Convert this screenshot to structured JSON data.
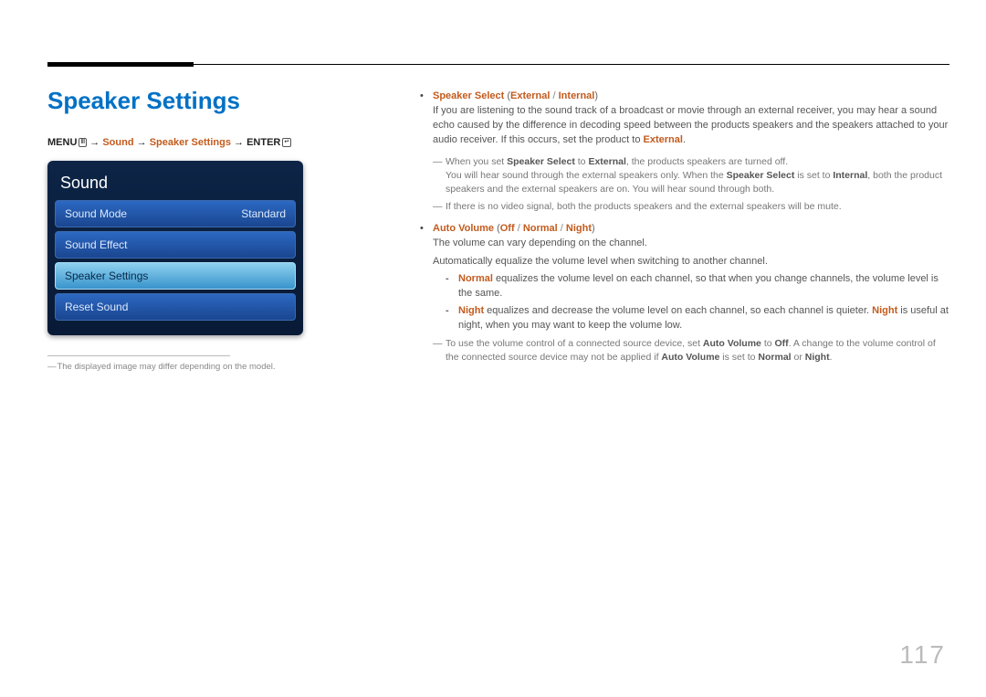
{
  "page_number": "117",
  "title": "Speaker Settings",
  "breadcrumb": {
    "menu": "MENU",
    "menu_icon": "Ⅲ",
    "arrow": "→",
    "sound": "Sound",
    "speaker_settings": "Speaker Settings",
    "enter": "ENTER",
    "enter_icon": "↵"
  },
  "osd": {
    "title": "Sound",
    "items": [
      {
        "label": "Sound Mode",
        "value": "Standard",
        "selected": false
      },
      {
        "label": "Sound Effect",
        "value": "",
        "selected": false
      },
      {
        "label": "Speaker Settings",
        "value": "",
        "selected": true
      },
      {
        "label": "Reset Sound",
        "value": "",
        "selected": false
      }
    ]
  },
  "left_footnote": "The displayed image may differ depending on the model.",
  "right": {
    "speaker_select": {
      "heading": "Speaker Select",
      "opt1": "External",
      "opt2": "Internal",
      "body": "If you are listening to the sound track of a broadcast or movie through an external receiver, you may hear a sound echo caused by the difference in decoding speed between the products speakers and the speakers attached to your audio receiver. If this occurs, set the product to ",
      "body_end_bold": "External",
      "note1_a": "When you set ",
      "note1_b": "Speaker Select",
      "note1_c": " to ",
      "note1_d": "External",
      "note1_e": ", the products speakers are turned off.",
      "note1_line2_a": "You will hear sound through the external speakers only. When the ",
      "note1_line2_b": "Speaker Select",
      "note1_line2_c": " is set to ",
      "note1_line2_d": "Internal",
      "note1_line2_e": ", both the product speakers and the external speakers are on. You will hear sound through both.",
      "note2": "If there is no video signal, both the products speakers and the external speakers will be mute."
    },
    "auto_volume": {
      "heading": "Auto Volume",
      "opt1": "Off",
      "opt2": "Normal",
      "opt3": "Night",
      "line1": "The volume can vary depending on the channel.",
      "line2": "Automatically equalize the volume level when switching to another channel.",
      "normal_bold": "Normal",
      "normal_text": " equalizes the volume level on each channel, so that when you change channels, the volume level is the same.",
      "night_bold1": "Night",
      "night_text1": " equalizes and decrease the volume level on each channel, so each channel is quieter. ",
      "night_bold2": "Night",
      "night_text2": " is useful at night, when you may want to keep the volume low.",
      "note_a": "To use the volume control of a connected source device, set ",
      "note_b": "Auto Volume",
      "note_c": " to ",
      "note_d": "Off",
      "note_e": ". A change to the volume control of the connected source device may not be applied if ",
      "note_f": "Auto Volume",
      "note_g": " is set to ",
      "note_h": "Normal",
      "note_i": " or ",
      "note_j": "Night",
      "note_k": "."
    }
  }
}
